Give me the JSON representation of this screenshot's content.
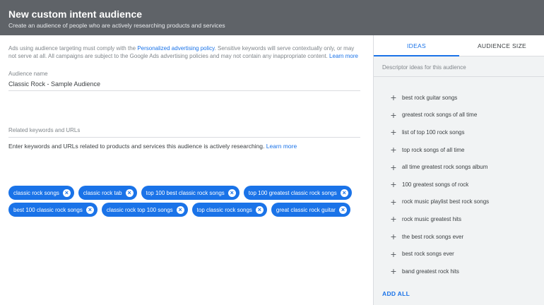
{
  "header": {
    "title": "New custom intent audience",
    "subtitle": "Create an audience of people who are actively researching products and services"
  },
  "policy": {
    "text_before": "Ads using audience targeting must comply with the ",
    "policy_link": "Personalized advertising policy",
    "text_after": ". Sensitive keywords will serve contextually only, or may not serve at all. All campaigns are subject to the Google Ads advertising policies and may not contain any inappropriate content. ",
    "learn_more": "Learn more"
  },
  "audience": {
    "label": "Audience name",
    "value": "Classic Rock - Sample Audience"
  },
  "instructions": {
    "text": "Enter keywords and URLs related to products and services this audience is actively researching. ",
    "learn_more": "Learn more"
  },
  "keywords": {
    "label": "Related keywords and URLs",
    "rows": [
      [
        "classic rock songs",
        "classic rock tab",
        "top 100 best classic rock songs",
        "top 100 greatest classic rock songs"
      ],
      [
        "best 100 classic rock songs",
        "classic rock top 100 songs",
        "top classic rock songs",
        "great classic rock guitar"
      ]
    ]
  },
  "tabs": [
    "IDEAS",
    "AUDIENCE SIZE"
  ],
  "ideas": {
    "description": "Descriptor ideas for this audience",
    "items": [
      "best rock guitar songs",
      "greatest rock songs of all time",
      "list of top 100 rock songs",
      "top rock songs of all time",
      "all time greatest rock songs album",
      "100 greatest songs of rock",
      "rock music playlist best rock songs",
      "rock music greatest hits",
      "the best rock songs ever",
      "best rock songs ever",
      "band greatest rock hits"
    ],
    "add_all": "ADD ALL"
  },
  "colors": {
    "header_bg": "#5f6368",
    "accent": "#1a73e8",
    "panel_bg": "#f1f3f4"
  },
  "icons": {
    "chip_remove": "close-circle-icon",
    "add_idea": "plus-icon"
  }
}
